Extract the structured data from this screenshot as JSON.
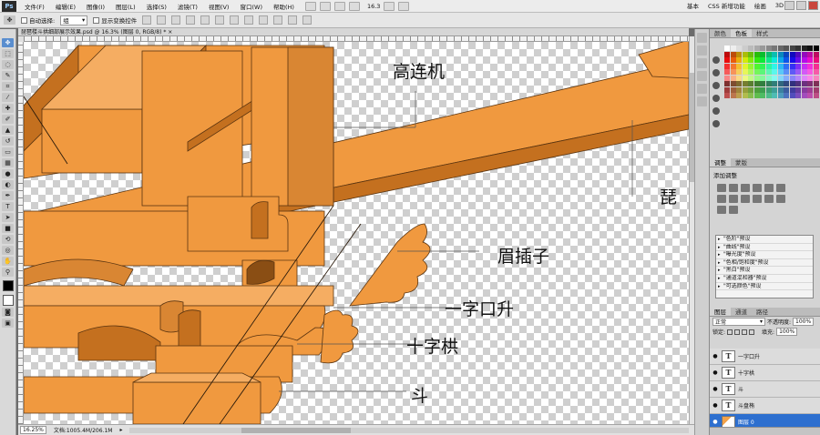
{
  "menubar": {
    "logo": "Ps",
    "items": [
      "文件(F)",
      "编辑(E)",
      "图像(I)",
      "图层(L)",
      "选择(S)",
      "滤镜(T)",
      "视图(V)",
      "窗口(W)",
      "帮助(H)"
    ],
    "zoom": "16.3",
    "workspace": [
      "基本",
      "CSS 新增功能",
      "绘画",
      "3D"
    ]
  },
  "options": {
    "auto_select_label": "自动选择:",
    "auto_select_target": "组",
    "show_transform_label": "显示变换控件"
  },
  "document": {
    "tab_title": "琵琶楼斗拱细部展示效果.psd @ 16.3% (图层 0, RGB/8) * ×",
    "labels": [
      "高连机",
      "琵",
      "眉插子",
      "一字口升",
      "十字栱",
      "斗"
    ]
  },
  "status": {
    "zoom": "16.25%",
    "doc_size": "文档:1005.4M/206.1M"
  },
  "panels": {
    "color_tabs": [
      "颜色",
      "色板",
      "样式"
    ],
    "adjust_tabs": [
      "调整",
      "蒙版"
    ],
    "adjust_title": "添加调整",
    "presets": [
      "\"色阶\"预设",
      "\"曲线\"预设",
      "\"曝光度\"预设",
      "\"色相/饱和度\"预设",
      "\"黑白\"预设",
      "\"通道混和器\"预设",
      "\"可选颜色\"预设"
    ],
    "layer_tabs": [
      "图层",
      "通道",
      "路径"
    ],
    "blend_mode": "正常",
    "opacity_label": "不透明度:",
    "opacity": "100%",
    "lock_label": "锁定:",
    "fill_label": "填充:",
    "fill": "100%",
    "layers": [
      {
        "name": "一字口升",
        "kind": "T"
      },
      {
        "name": "十字栱",
        "kind": "T"
      },
      {
        "name": "斗",
        "kind": "T"
      },
      {
        "name": "斗盘栯",
        "kind": "T"
      },
      {
        "name": "图层 0",
        "kind": "image",
        "selected": true
      }
    ]
  },
  "colors": {
    "wood": "#f0993f",
    "wood_dark": "#c4701f",
    "selection": "#2d6fcf"
  }
}
